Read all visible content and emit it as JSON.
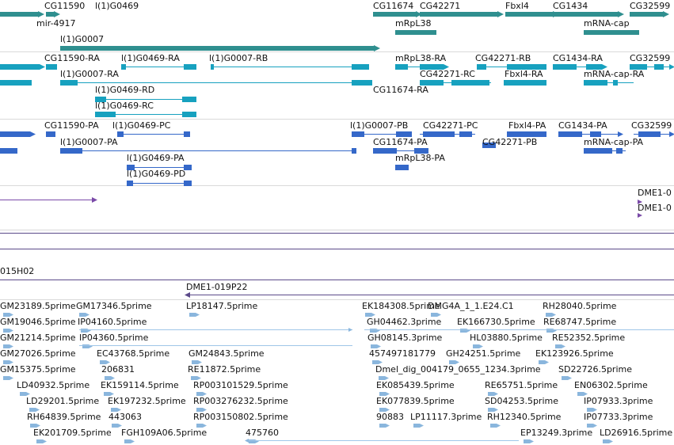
{
  "colors": {
    "gene": "#2f8f8f",
    "mrna": "#17a1bf",
    "cds": "#3568c9",
    "clone": "#7a4aa8",
    "est": "#8ab6dd",
    "divider": "#d9d9d9",
    "clone_line": "#5b4a8a"
  },
  "tracks": {
    "genes": {
      "items": [
        {
          "label": "CG11590",
          "strand": "+"
        },
        {
          "label": "l(1)G0469",
          "strand": "+"
        },
        {
          "label": "mir-4917",
          "strand": "+"
        },
        {
          "label": "l(1)G0007",
          "strand": "+"
        },
        {
          "label": "CG11674",
          "strand": "+"
        },
        {
          "label": "CG42271",
          "strand": "+"
        },
        {
          "label": "mRpL38",
          "strand": "+"
        },
        {
          "label": "Fbxl4",
          "strand": "+"
        },
        {
          "label": "CG1434",
          "strand": "+"
        },
        {
          "label": "mRNA-cap",
          "strand": "+"
        },
        {
          "label": "CG32599",
          "strand": "+"
        }
      ]
    },
    "transcripts": {
      "items": [
        {
          "label": "CG11590-RA"
        },
        {
          "label": "l(1)G0469-RA"
        },
        {
          "label": "l(1)G0007-RB"
        },
        {
          "label": "mRpL38-RA"
        },
        {
          "label": "CG42271-RB"
        },
        {
          "label": "CG1434-RA"
        },
        {
          "label": "CG32599"
        },
        {
          "label": "l(1)G0007-RA"
        },
        {
          "label": "CG42271-RC"
        },
        {
          "label": "Fbxl4-RA"
        },
        {
          "label": "mRNA-cap-RA"
        },
        {
          "label": "l(1)G0469-RD"
        },
        {
          "label": "CG11674-RA"
        },
        {
          "label": "l(1)G0469-RC"
        }
      ]
    },
    "proteins": {
      "items": [
        {
          "label": "CG11590-PA"
        },
        {
          "label": "l(1)G0469-PC"
        },
        {
          "label": "l(1)G0007-PB"
        },
        {
          "label": "CG42271-PC"
        },
        {
          "label": "Fbxl4-PA"
        },
        {
          "label": "CG1434-PA"
        },
        {
          "label": "CG32599"
        },
        {
          "label": "l(1)G0007-PA"
        },
        {
          "label": "CG11674-PA"
        },
        {
          "label": "CG42271-PB"
        },
        {
          "label": "mRNA-cap-PA"
        },
        {
          "label": "l(1)G0469-PA"
        },
        {
          "label": "mRpL38-PA"
        },
        {
          "label": "l(1)G0469-PD"
        }
      ]
    },
    "clones": {
      "items": [
        {
          "label": "DME1-0"
        },
        {
          "label": "DME1-0"
        },
        {
          "label": "015H02"
        },
        {
          "label": "DME1-019P22"
        }
      ]
    },
    "ests": {
      "items": [
        {
          "label": "GM23189.5prime"
        },
        {
          "label": "GM17346.5prime"
        },
        {
          "label": "LP18147.5prime"
        },
        {
          "label": "EK184308.5prime"
        },
        {
          "label": "DMG4A_1_1.E24.C1"
        },
        {
          "label": "RH28040.5prime"
        },
        {
          "label": "GM19046.5prime"
        },
        {
          "label": "IP04160.5prime"
        },
        {
          "label": "GH04462.3prime"
        },
        {
          "label": "EK166730.5prime"
        },
        {
          "label": "RE68747.5prime"
        },
        {
          "label": "GM21214.5prime"
        },
        {
          "label": "IP04360.5prime"
        },
        {
          "label": "GH08145.3prime"
        },
        {
          "label": "HL03880.5prime"
        },
        {
          "label": "RE52352.5prime"
        },
        {
          "label": "GM27026.5prime"
        },
        {
          "label": "EC43768.5prime"
        },
        {
          "label": "GM24843.5prime"
        },
        {
          "label": "457497181779"
        },
        {
          "label": "GH24251.5prime"
        },
        {
          "label": "EK123926.5prime"
        },
        {
          "label": "GM15375.5prime"
        },
        {
          "label": "206831"
        },
        {
          "label": "RE11872.5prime"
        },
        {
          "label": "Dmel_dig_004179_0655_1234.3prime"
        },
        {
          "label": "SD22726.5prime"
        },
        {
          "label": "LD40932.5prime"
        },
        {
          "label": "EK159114.5prime"
        },
        {
          "label": "RP003101529.5prime"
        },
        {
          "label": "EK085439.5prime"
        },
        {
          "label": "RE65751.5prime"
        },
        {
          "label": "EN06302.5prime"
        },
        {
          "label": "LD29201.5prime"
        },
        {
          "label": "EK197232.5prime"
        },
        {
          "label": "RP003276232.5prime"
        },
        {
          "label": "EK077839.5prime"
        },
        {
          "label": "SD04253.5prime"
        },
        {
          "label": "IP07933.3prime"
        },
        {
          "label": "RH64839.5prime"
        },
        {
          "label": "443063"
        },
        {
          "label": "RP003150802.5prime"
        },
        {
          "label": "90883"
        },
        {
          "label": "LP11117.3prime"
        },
        {
          "label": "RH12340.5prime"
        },
        {
          "label": "IP07733.3prime"
        },
        {
          "label": "EK201709.5prime"
        },
        {
          "label": "FGH109A06.5prime"
        },
        {
          "label": "475760"
        },
        {
          "label": "EP13249.3prime"
        },
        {
          "label": "LD26916.5prime"
        }
      ]
    }
  }
}
